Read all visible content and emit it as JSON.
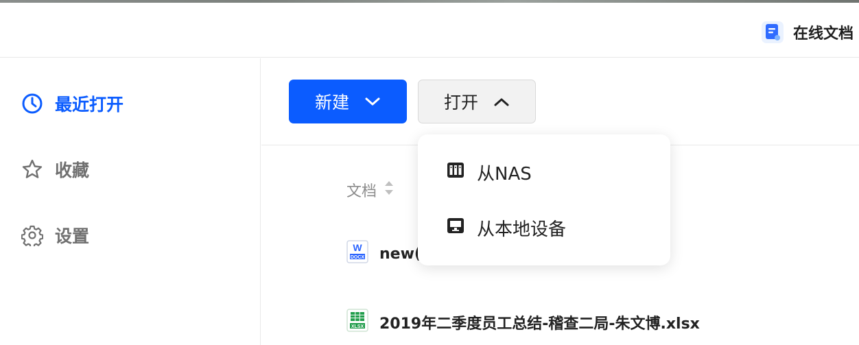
{
  "header": {
    "app_title": "在线文档"
  },
  "sidebar": {
    "items": [
      {
        "label": "最近打开",
        "icon": "clock-icon",
        "active": true
      },
      {
        "label": "收藏",
        "icon": "star-icon",
        "active": false
      },
      {
        "label": "设置",
        "icon": "gear-icon",
        "active": false
      }
    ]
  },
  "toolbar": {
    "new_label": "新建",
    "open_label": "打开"
  },
  "list": {
    "column_header": "文档",
    "files": [
      {
        "name": "new(",
        "type": "docx",
        "icon_text": "W",
        "icon_sub": "DOCX"
      },
      {
        "name": "2019年二季度员工总结-稽查二局-朱文博.xlsx",
        "type": "xlsx",
        "icon_sub": "XLSX"
      }
    ]
  },
  "open_menu": {
    "items": [
      {
        "label": "从NAS",
        "icon": "nas-icon"
      },
      {
        "label": "从本地设备",
        "icon": "monitor-icon"
      }
    ]
  },
  "colors": {
    "accent": "#0b5cff",
    "text": "#222222",
    "muted": "#707070"
  }
}
